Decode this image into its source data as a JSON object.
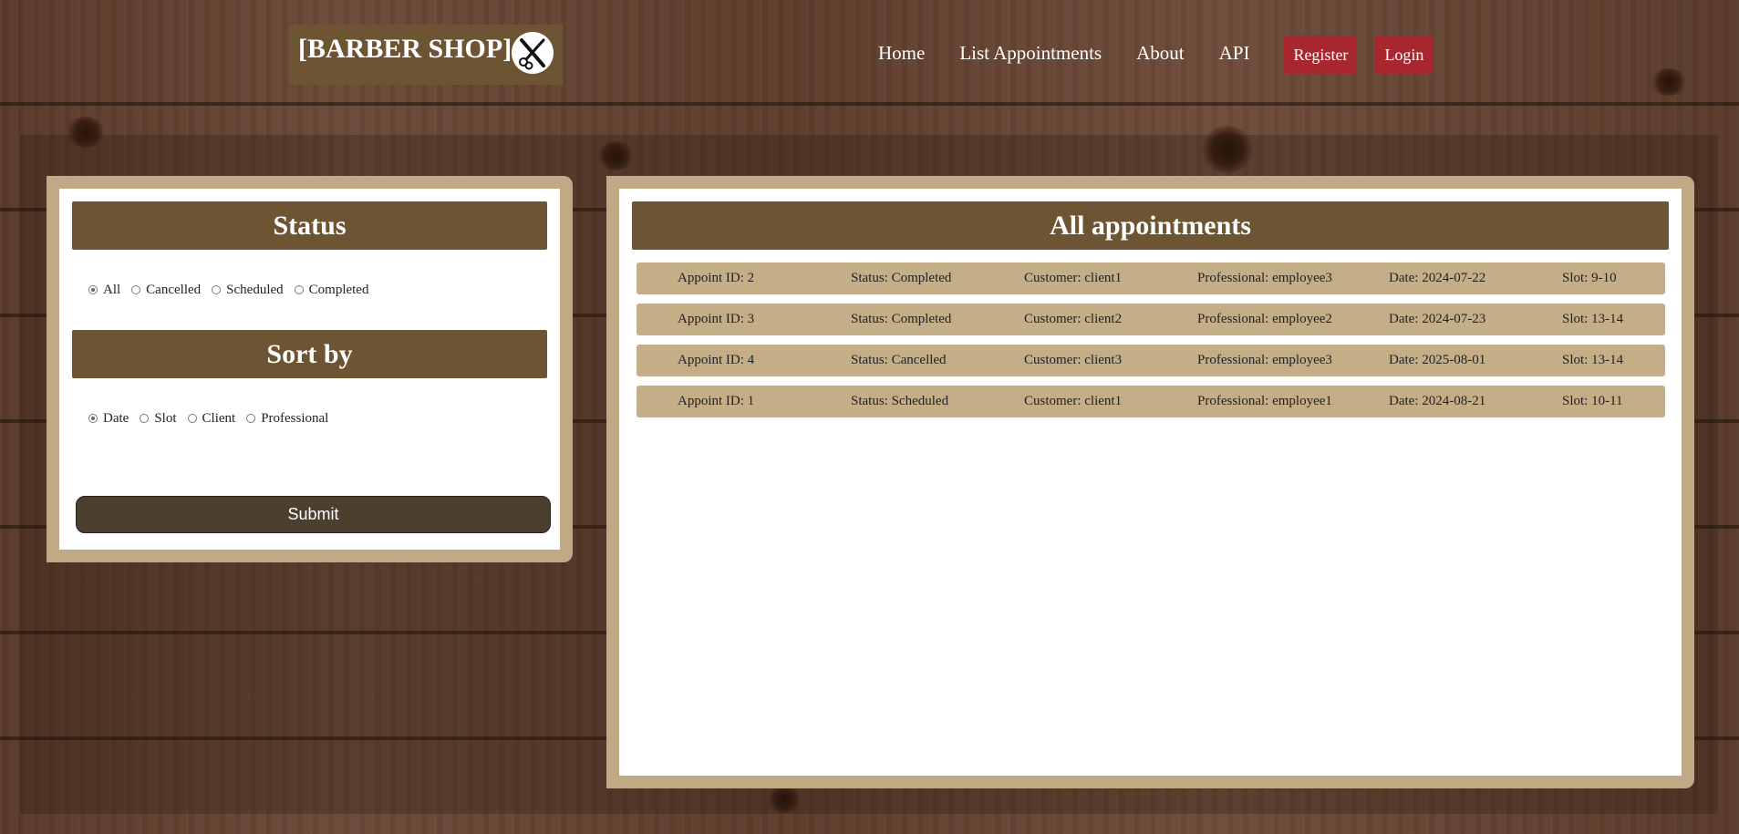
{
  "header": {
    "logo_text": "[BARBER SHOP]",
    "logo_icon": "scissors-razor-icon",
    "nav_links": [
      "Home",
      "List Appointments",
      "About",
      "API"
    ],
    "nav_buttons": [
      "Register",
      "Login"
    ]
  },
  "filters": {
    "status_title": "Status",
    "status_options": [
      "All",
      "Cancelled",
      "Scheduled",
      "Completed"
    ],
    "status_selected": "All",
    "sort_title": "Sort by",
    "sort_options": [
      "Date",
      "Slot",
      "Client",
      "Professional"
    ],
    "sort_selected": "Date",
    "submit_label": "Submit"
  },
  "appointments": {
    "title": "All appointments",
    "rows": [
      {
        "id": "Appoint ID: 2",
        "status": "Status: Completed",
        "customer": "Customer: client1",
        "professional": "Professional: employee3",
        "date": "Date: 2024-07-22",
        "slot": "Slot: 9-10"
      },
      {
        "id": "Appoint ID: 3",
        "status": "Status: Completed",
        "customer": "Customer: client2",
        "professional": "Professional: employee2",
        "date": "Date: 2024-07-23",
        "slot": "Slot: 13-14"
      },
      {
        "id": "Appoint ID: 4",
        "status": "Status: Cancelled",
        "customer": "Customer: client3",
        "professional": "Professional: employee3",
        "date": "Date: 2025-08-01",
        "slot": "Slot: 13-14"
      },
      {
        "id": "Appoint ID: 1",
        "status": "Status: Scheduled",
        "customer": "Customer: client1",
        "professional": "Professional: employee1",
        "date": "Date: 2024-08-21",
        "slot": "Slot: 10-11"
      }
    ]
  },
  "colors": {
    "brand_brown": "#6d5433",
    "panel_tan": "#c0aa86",
    "nav_button_red": "#a8272f",
    "submit_dark": "#4b3f30"
  }
}
